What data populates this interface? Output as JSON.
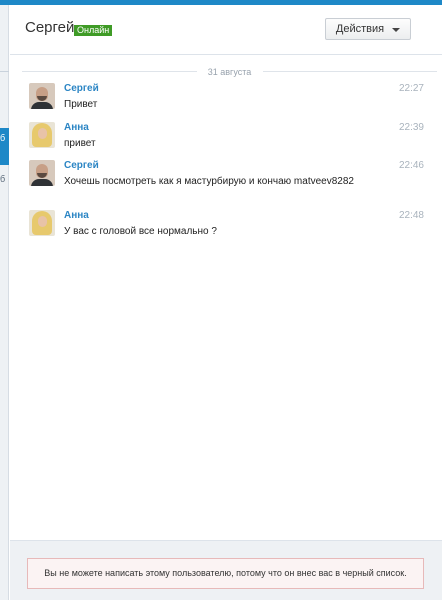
{
  "header": {
    "user_name": "Сергей",
    "status": "Онлайн",
    "actions_label": "Действия"
  },
  "left_strip": {
    "glyph_top": "б",
    "glyph_bottom": "б"
  },
  "date_divider": "31 августа",
  "messages": [
    {
      "author": "Сергей",
      "time": "22:27",
      "text": "Привет",
      "avatar": "male-avatar-icon"
    },
    {
      "author": "Анна",
      "time": "22:39",
      "text": "привет",
      "avatar": "female-avatar-icon"
    },
    {
      "author": "Сергей",
      "time": "22:46",
      "text": "Хочешь посмотреть как я мастурбирую и кончаю matveev8282",
      "avatar": "male-avatar-icon"
    },
    {
      "author": "Анна",
      "time": "22:48",
      "text": "У вас с головой все нормально ?",
      "avatar": "female-avatar-icon"
    }
  ],
  "footer": {
    "notice": "Вы не можете написать этому пользователю, потому что он внес вас в черный список."
  },
  "colors": {
    "accent": "#1e88c7",
    "author": "#2b85c4",
    "online": "#3f9b26",
    "notice_border": "#e7b9b9"
  }
}
